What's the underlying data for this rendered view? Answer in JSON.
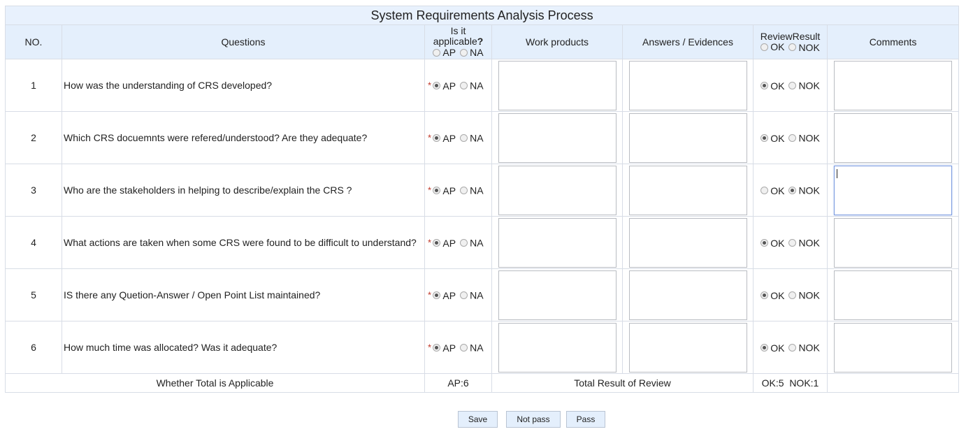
{
  "title": "System Requirements Analysis Process",
  "headers": {
    "no": "NO.",
    "questions": "Questions",
    "applicable_line1": "Is it",
    "applicable_line2": "applicable",
    "applicable_help": "?",
    "ap": "AP",
    "na": "NA",
    "work_products": "Work products",
    "answers": "Answers / Evidences",
    "review_result": "ReviewResult",
    "ok": "OK",
    "nok": "NOK",
    "comments": "Comments"
  },
  "required_mark": "*",
  "rows": [
    {
      "no": "1",
      "question": "How was the understanding of CRS developed?",
      "applicable": "AP",
      "review": "OK",
      "comment": ""
    },
    {
      "no": "2",
      "question": "Which CRS docuemnts were refered/understood? Are they adequate?",
      "applicable": "AP",
      "review": "OK",
      "comment": ""
    },
    {
      "no": "3",
      "question": "Who are the stakeholders in helping to describe/explain the CRS ?",
      "applicable": "AP",
      "review": "NOK",
      "comment": ""
    },
    {
      "no": "4",
      "question": "What actions are taken when some CRS were found to be difficult to understand?",
      "applicable": "AP",
      "review": "OK",
      "comment": ""
    },
    {
      "no": "5",
      "question": "IS there any Quetion-Answer / Open Point List maintained?",
      "applicable": "AP",
      "review": "OK",
      "comment": ""
    },
    {
      "no": "6",
      "question": "How much time was allocated? Was it adequate?",
      "applicable": "AP",
      "review": "OK",
      "comment": ""
    }
  ],
  "totals": {
    "applicable_label": "Whether Total is Applicable",
    "applicable_value": "AP:6",
    "review_label": "Total Result of Review",
    "review_value": "OK:5  NOK:1"
  },
  "buttons": {
    "save": "Save",
    "not_pass": "Not pass",
    "pass": "Pass"
  }
}
